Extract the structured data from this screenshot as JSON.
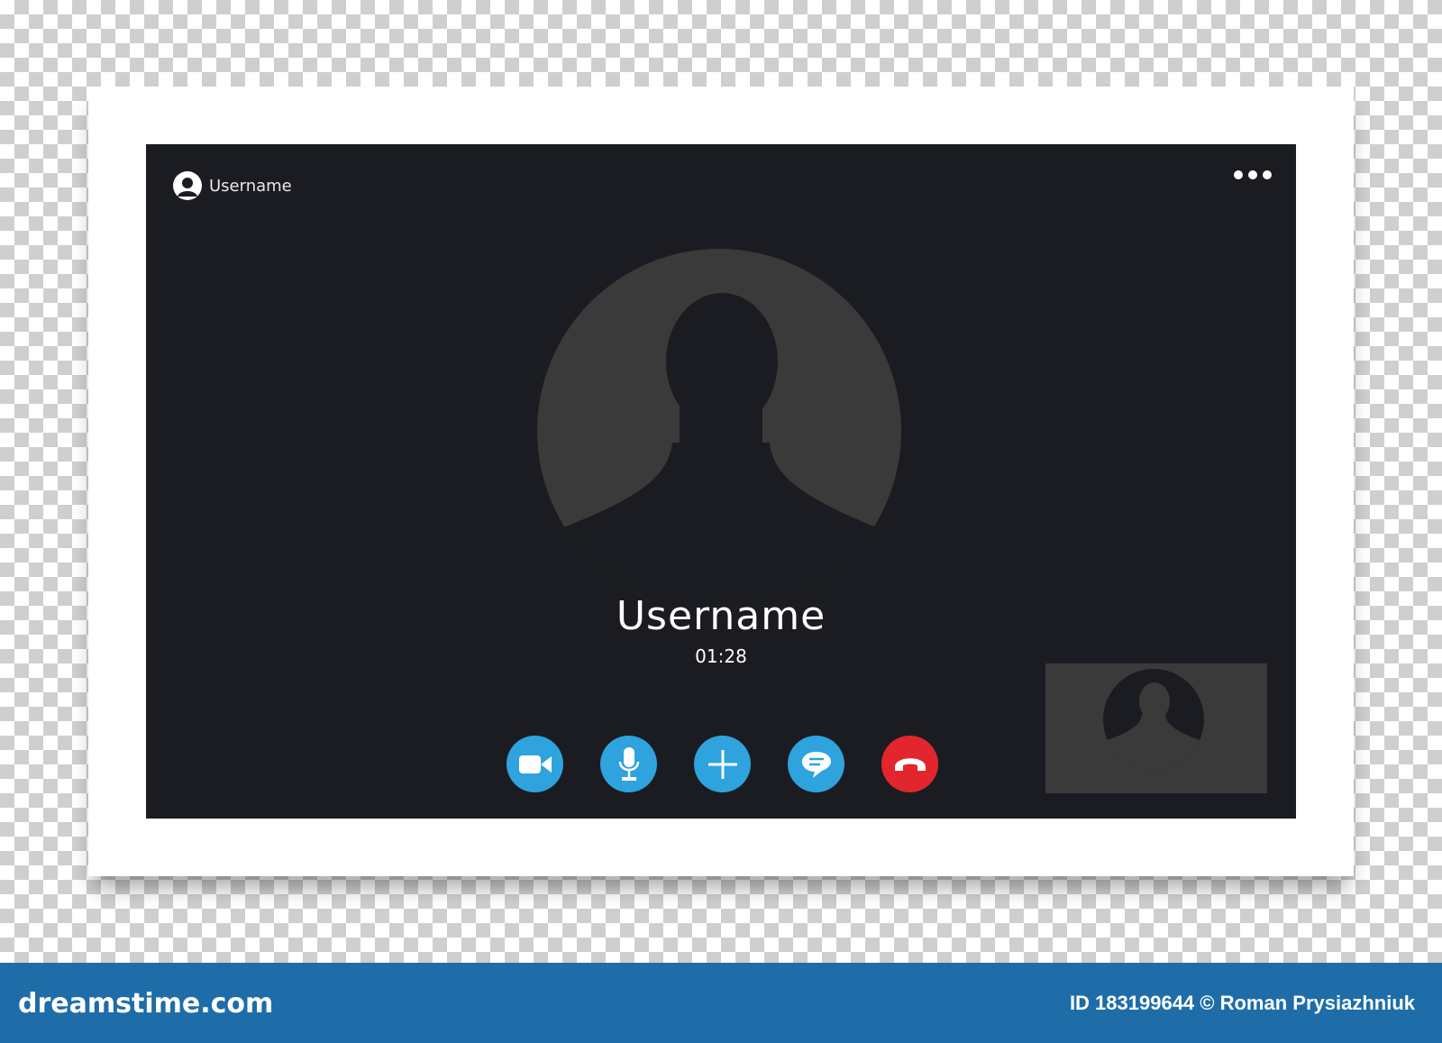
{
  "header": {
    "username": "Username"
  },
  "call": {
    "caller_name": "Username",
    "duration": "01:28"
  },
  "controls": [
    {
      "name": "video-button",
      "icon": "video-camera-icon",
      "color": "#2ea3dd"
    },
    {
      "name": "microphone-button",
      "icon": "microphone-icon",
      "color": "#2ea3dd"
    },
    {
      "name": "add-participant-button",
      "icon": "plus-icon",
      "color": "#2ea3dd"
    },
    {
      "name": "chat-button",
      "icon": "chat-bubble-icon",
      "color": "#2ea3dd"
    },
    {
      "name": "end-call-button",
      "icon": "hang-up-icon",
      "color": "#e3262d"
    }
  ],
  "colors": {
    "screen_bg": "#1b1c21",
    "avatar_circle": "#3a3a3b",
    "accent": "#2ea3dd",
    "danger": "#e3262d"
  },
  "watermark": {
    "logo": "dreamstime.com",
    "credit": "ID 183199644 © Roman Prysiazhniuk"
  }
}
